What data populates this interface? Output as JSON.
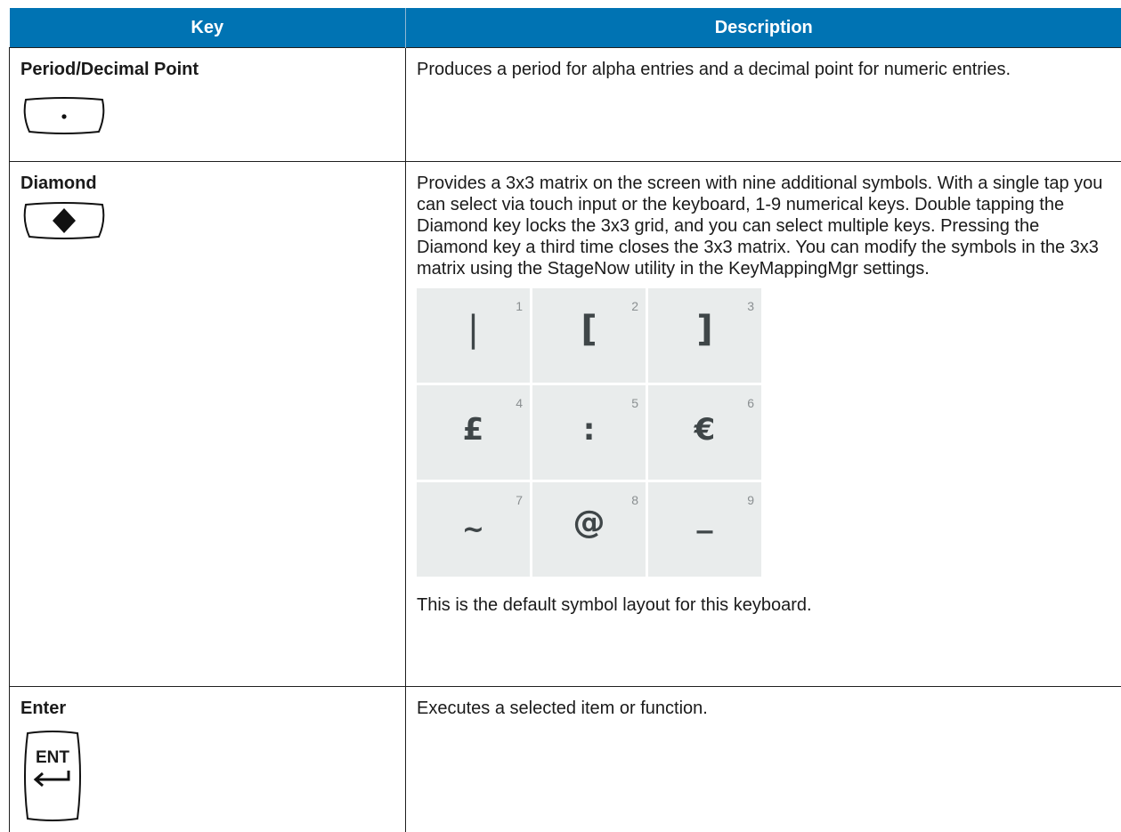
{
  "header": {
    "key": "Key",
    "description": "Description"
  },
  "rows": [
    {
      "key_name": "Period/Decimal Point",
      "key_icon": "period-key-icon",
      "description": "Produces a period for alpha entries and a decimal point for numeric entries."
    },
    {
      "key_name": "Diamond",
      "key_icon": "diamond-key-icon",
      "description": "Provides a 3x3 matrix on the screen with nine additional symbols. With a single tap you can select via touch input or the keyboard, 1-9 numerical keys. Double tapping the Diamond key locks the 3x3 grid, and you can select multiple keys. Pressing the Diamond key a third time closes the 3x3 matrix. You can modify the symbols in the 3x3 matrix using the StageNow utility in the KeyMappingMgr settings.",
      "matrix": [
        {
          "num": "1",
          "symbol": "|"
        },
        {
          "num": "2",
          "symbol": "["
        },
        {
          "num": "3",
          "symbol": "]"
        },
        {
          "num": "4",
          "symbol": "£"
        },
        {
          "num": "5",
          "symbol": ":"
        },
        {
          "num": "6",
          "symbol": "€"
        },
        {
          "num": "7",
          "symbol": "~"
        },
        {
          "num": "8",
          "symbol": "@"
        },
        {
          "num": "9",
          "symbol": "_"
        }
      ],
      "footer": "This is the default symbol layout for this keyboard."
    },
    {
      "key_name": "Enter",
      "key_icon": "enter-key-icon",
      "key_label": "ENT",
      "description": "Executes a selected item or function."
    }
  ],
  "colors": {
    "header_bg": "#0073b3",
    "grid_cell_bg": "#e9ecec"
  }
}
